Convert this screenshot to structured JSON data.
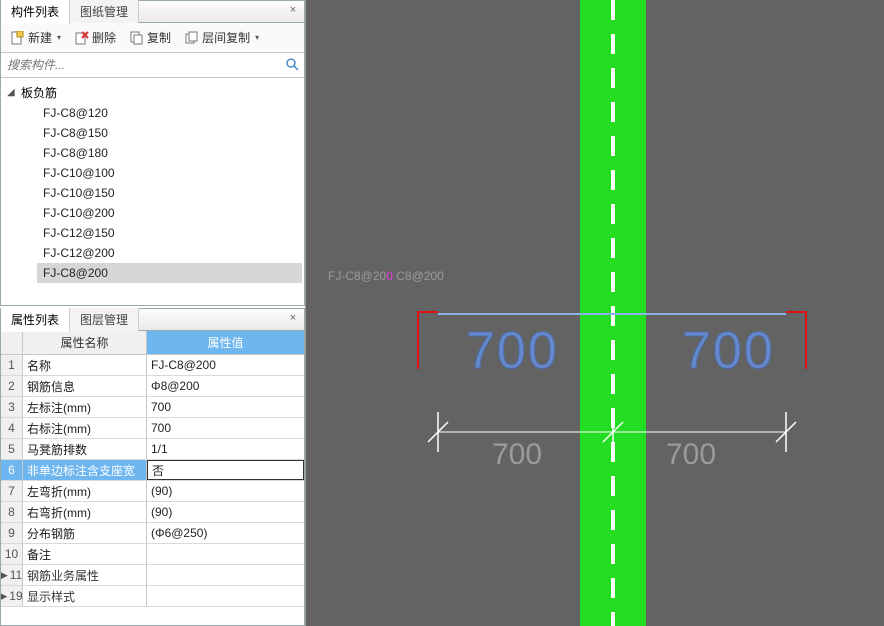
{
  "tabs_top": {
    "components": "构件列表",
    "drawings": "图纸管理"
  },
  "tabs_bottom": {
    "properties": "属性列表",
    "layers": "图层管理"
  },
  "toolbar": {
    "new": "新建",
    "delete": "删除",
    "copy": "复制",
    "layer_copy": "层间复制"
  },
  "search": {
    "placeholder": "搜索构件..."
  },
  "tree": {
    "parent": "板负筋",
    "items": [
      "FJ-C8@120",
      "FJ-C8@150",
      "FJ-C8@180",
      "FJ-C10@100",
      "FJ-C10@150",
      "FJ-C10@200",
      "FJ-C12@150",
      "FJ-C12@200",
      "FJ-C8@200"
    ],
    "selected_index": 8
  },
  "grid": {
    "header_name": "属性名称",
    "header_value": "属性值",
    "rows": [
      {
        "n": "1",
        "name": "名称",
        "value": "FJ-C8@200"
      },
      {
        "n": "2",
        "name": "钢筋信息",
        "value": "Φ8@200"
      },
      {
        "n": "3",
        "name": "左标注(mm)",
        "value": "700"
      },
      {
        "n": "4",
        "name": "右标注(mm)",
        "value": "700"
      },
      {
        "n": "5",
        "name": "马凳筋排数",
        "value": "1/1"
      },
      {
        "n": "6",
        "name": "非单边标注含支座宽",
        "value": "否",
        "selected": true
      },
      {
        "n": "7",
        "name": "左弯折(mm)",
        "value": "(90)"
      },
      {
        "n": "8",
        "name": "右弯折(mm)",
        "value": "(90)"
      },
      {
        "n": "9",
        "name": "分布钢筋",
        "value": "(Φ6@250)"
      },
      {
        "n": "10",
        "name": "备注",
        "value": ""
      },
      {
        "n": "11",
        "name": "钢筋业务属性",
        "value": "",
        "cat": true
      },
      {
        "n": "19",
        "name": "显示样式",
        "value": "",
        "cat": true
      }
    ]
  },
  "viewport": {
    "label_left": "FJ-C8@20",
    "label_pink": "0",
    "label_right": "C8@200",
    "blue_left": "700",
    "blue_right": "700",
    "dim_left": "700",
    "dim_right": "700"
  }
}
